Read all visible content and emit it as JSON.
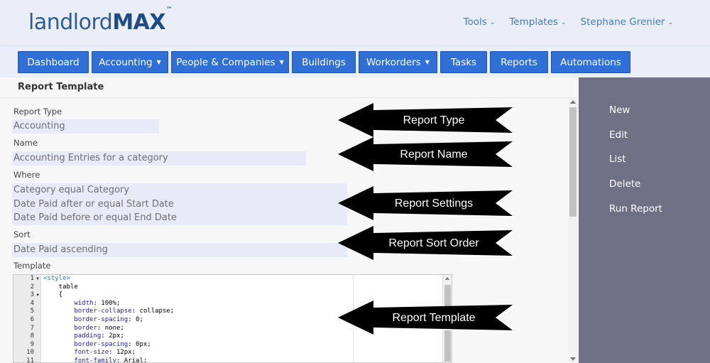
{
  "header": {
    "logo_light": "landlord",
    "logo_bold": "MAX",
    "logo_tm": "™",
    "top_nav": [
      {
        "label": "Tools"
      },
      {
        "label": "Templates"
      },
      {
        "label": "Stephane Grenier"
      }
    ]
  },
  "menu": [
    {
      "label": "Dashboard",
      "dropdown": false
    },
    {
      "label": "Accounting",
      "dropdown": true
    },
    {
      "label": "People & Companies",
      "dropdown": true
    },
    {
      "label": "Buildings",
      "dropdown": false
    },
    {
      "label": "Workorders",
      "dropdown": true
    },
    {
      "label": "Tasks",
      "dropdown": false
    },
    {
      "label": "Reports",
      "dropdown": false
    },
    {
      "label": "Automations",
      "dropdown": false
    }
  ],
  "page": {
    "title": "Report Template",
    "fields": {
      "report_type": {
        "label": "Report Type",
        "value": "Accounting"
      },
      "name": {
        "label": "Name",
        "value": "Accounting Entries for a category"
      },
      "where": {
        "label": "Where",
        "lines": [
          "Category equal Category",
          "Date Paid after or equal Start Date",
          "Date Paid before or equal End Date"
        ]
      },
      "sort": {
        "label": "Sort",
        "value": "Date Paid ascending"
      },
      "template": {
        "label": "Template"
      }
    }
  },
  "editor": {
    "lines": [
      {
        "num": "1",
        "fold": true,
        "tag": "<style>",
        "prop": "",
        "rest": ""
      },
      {
        "num": "2",
        "fold": false,
        "tag": "",
        "prop": "",
        "rest": "    table"
      },
      {
        "num": "3",
        "fold": true,
        "tag": "",
        "prop": "",
        "rest": "    {"
      },
      {
        "num": "4",
        "fold": false,
        "tag": "",
        "prop": "        width",
        "rest": ": 100%;"
      },
      {
        "num": "5",
        "fold": false,
        "tag": "",
        "prop": "        border-collapse",
        "rest": ": collapse;"
      },
      {
        "num": "6",
        "fold": false,
        "tag": "",
        "prop": "        border-spacing",
        "rest": ": 0;"
      },
      {
        "num": "7",
        "fold": false,
        "tag": "",
        "prop": "        border",
        "rest": ": none;"
      },
      {
        "num": "8",
        "fold": false,
        "tag": "",
        "prop": "        padding",
        "rest": ": 2px;"
      },
      {
        "num": "9",
        "fold": false,
        "tag": "",
        "prop": "        border-spacing",
        "rest": ": 0px;"
      },
      {
        "num": "10",
        "fold": false,
        "tag": "",
        "prop": "        font-size",
        "rest": ": 12px;"
      },
      {
        "num": "11",
        "fold": false,
        "tag": "",
        "prop": "        font-family",
        "rest": ": Arial;"
      }
    ]
  },
  "sidebar": {
    "links": [
      {
        "label": "New"
      },
      {
        "label": "Edit"
      },
      {
        "label": "List"
      },
      {
        "label": "Delete"
      },
      {
        "label": "Run Report"
      }
    ]
  },
  "annotations": {
    "report_type": "Report Type",
    "report_name": "Report Name",
    "report_settings": "Report Settings",
    "report_sort_order": "Report Sort Order",
    "report_template": "Report Template"
  },
  "colors": {
    "header_bg": "#e9eef8",
    "menu_button": "#2f6fd6",
    "link_blue": "#4a7ab8",
    "sidebar_bg": "#6e7185",
    "field_bg": "#e6ebf7",
    "arrow_fill": "#000000"
  }
}
